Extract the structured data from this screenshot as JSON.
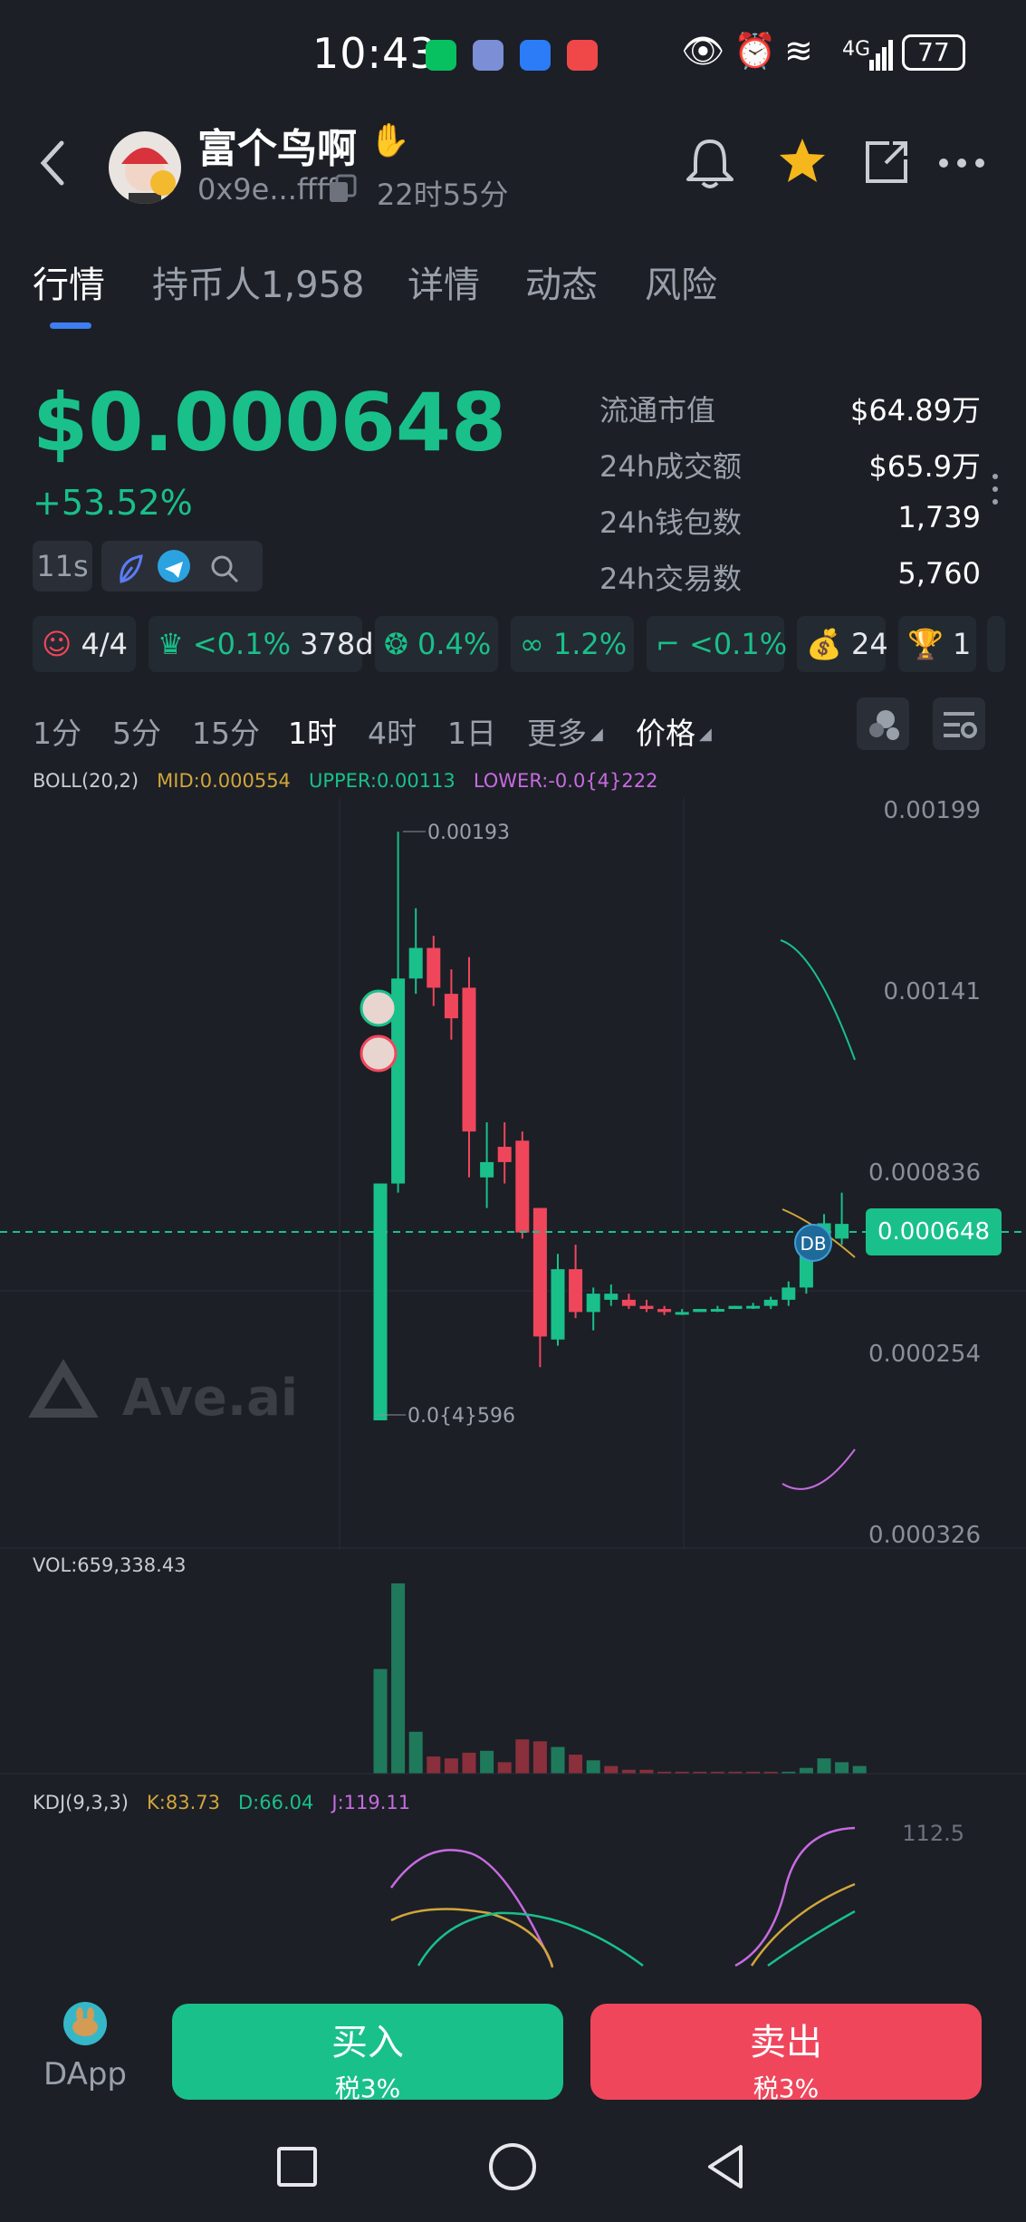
{
  "status_bar": {
    "time": "10:43",
    "network": "4G",
    "battery": "77"
  },
  "header": {
    "title": "富个鸟啊",
    "address": "0x9e...ffff",
    "age": "22时55分"
  },
  "tabs": [
    "行情",
    "持币人1,958",
    "详情",
    "动态",
    "风险"
  ],
  "price": {
    "value": "$0.000648",
    "change": "+53.52%"
  },
  "refresh": "11s",
  "stats": [
    {
      "label": "流通市值",
      "value": "$64.89万"
    },
    {
      "label": "24h成交额",
      "value": "$65.9万"
    },
    {
      "label": "24h钱包数",
      "value": "1,739"
    },
    {
      "label": "24h交易数",
      "value": "5,760"
    }
  ],
  "badges": [
    {
      "icon": "holder-icon",
      "text": "4/4",
      "color": "#e6e8ec"
    },
    {
      "icon": "chef-icon",
      "text": "<0.1%",
      "extra": "378d",
      "color": "#19c08a"
    },
    {
      "icon": "bundle-icon",
      "text": "0.4%",
      "color": "#19c08a"
    },
    {
      "icon": "link-icon",
      "text": "1.2%",
      "color": "#19c08a"
    },
    {
      "icon": "sniper-icon",
      "text": "<0.1%",
      "color": "#19c08a"
    },
    {
      "icon": "money-bag-icon",
      "text": "24",
      "color": "#e6e8ec"
    },
    {
      "icon": "trophy-icon",
      "text": "1",
      "color": "#e6e8ec"
    }
  ],
  "timeframes": [
    "1分",
    "5分",
    "15分",
    "1时",
    "4时",
    "1日",
    "更多",
    "价格"
  ],
  "active_timeframe": "1时",
  "boll": {
    "label": "BOLL(20,2)",
    "mid": "MID:0.000554",
    "upper": "UPPER:0.00113",
    "lower": "LOWER:-0.0{4}222"
  },
  "axis": {
    "y1": "0.00199",
    "y2": "0.00141",
    "y3": "0.000836",
    "y4": "0.000254",
    "y5": "0.000326",
    "current": "0.000648"
  },
  "annotations": {
    "high": "0.00193",
    "low": "0.0{4}596",
    "marker": "DB"
  },
  "watermark": "Ave.ai",
  "volume": {
    "label": "VOL:659,338.43"
  },
  "kdj": {
    "label": "KDJ(9,3,3)",
    "k": "K:83.73",
    "d": "D:66.04",
    "j": "J:119.11",
    "axis": "112.5"
  },
  "colors": {
    "up": "#19c08a",
    "down": "#f0465c",
    "accent": "#3d7ef0",
    "star": "#f5b71b"
  },
  "footer": {
    "dapp": "DApp",
    "buy": "买入",
    "buy_tax": "税3%",
    "sell": "卖出",
    "sell_tax": "税3%"
  },
  "chart_data": {
    "type": "candlestick",
    "ylim": [
      0.000326,
      0.00199
    ],
    "candles": [
      {
        "o": 5.96e-06,
        "h": 0.00078,
        "l": 5.96e-06,
        "c": 0.00078,
        "dir": "up"
      },
      {
        "o": 0.00078,
        "h": 0.00193,
        "l": 0.00075,
        "c": 0.00145,
        "dir": "up"
      },
      {
        "o": 0.00145,
        "h": 0.00168,
        "l": 0.0014,
        "c": 0.00155,
        "dir": "up"
      },
      {
        "o": 0.00155,
        "h": 0.00159,
        "l": 0.00136,
        "c": 0.00142,
        "dir": "down"
      },
      {
        "o": 0.0014,
        "h": 0.00148,
        "l": 0.00125,
        "c": 0.00132,
        "dir": "down"
      },
      {
        "o": 0.00142,
        "h": 0.00152,
        "l": 0.0008,
        "c": 0.00095,
        "dir": "down"
      },
      {
        "o": 0.0008,
        "h": 0.00098,
        "l": 0.0007,
        "c": 0.00085,
        "dir": "up"
      },
      {
        "o": 0.00085,
        "h": 0.00098,
        "l": 0.00078,
        "c": 0.0009,
        "dir": "down"
      },
      {
        "o": 0.00092,
        "h": 0.00095,
        "l": 0.0006,
        "c": 0.00062,
        "dir": "down"
      },
      {
        "o": 0.0007,
        "h": 0.0007,
        "l": 0.00018,
        "c": 0.00028,
        "dir": "down"
      },
      {
        "o": 0.00027,
        "h": 0.00055,
        "l": 0.00025,
        "c": 0.0005,
        "dir": "up"
      },
      {
        "o": 0.0005,
        "h": 0.00058,
        "l": 0.00034,
        "c": 0.00036,
        "dir": "down"
      },
      {
        "o": 0.00036,
        "h": 0.00044,
        "l": 0.0003,
        "c": 0.00042,
        "dir": "up"
      },
      {
        "o": 0.00042,
        "h": 0.00045,
        "l": 0.00038,
        "c": 0.0004,
        "dir": "up"
      },
      {
        "o": 0.0004,
        "h": 0.00042,
        "l": 0.00037,
        "c": 0.00038,
        "dir": "down"
      },
      {
        "o": 0.00038,
        "h": 0.0004,
        "l": 0.00036,
        "c": 0.00037,
        "dir": "down"
      },
      {
        "o": 0.00037,
        "h": 0.00038,
        "l": 0.00035,
        "c": 0.00036,
        "dir": "down"
      },
      {
        "o": 0.00036,
        "h": 0.00037,
        "l": 0.00035,
        "c": 0.00036,
        "dir": "up"
      },
      {
        "o": 0.00036,
        "h": 0.00037,
        "l": 0.00036,
        "c": 0.00037,
        "dir": "up"
      },
      {
        "o": 0.00037,
        "h": 0.00038,
        "l": 0.00036,
        "c": 0.00037,
        "dir": "up"
      },
      {
        "o": 0.00037,
        "h": 0.00038,
        "l": 0.00037,
        "c": 0.00038,
        "dir": "up"
      },
      {
        "o": 0.00038,
        "h": 0.00039,
        "l": 0.00037,
        "c": 0.00038,
        "dir": "up"
      },
      {
        "o": 0.00038,
        "h": 0.00041,
        "l": 0.00037,
        "c": 0.0004,
        "dir": "up"
      },
      {
        "o": 0.0004,
        "h": 0.00046,
        "l": 0.00038,
        "c": 0.00044,
        "dir": "up"
      },
      {
        "o": 0.00044,
        "h": 0.00058,
        "l": 0.00042,
        "c": 0.00056,
        "dir": "up"
      },
      {
        "o": 0.00056,
        "h": 0.00068,
        "l": 0.00054,
        "c": 0.00065,
        "dir": "up"
      },
      {
        "o": 0.0006,
        "h": 0.00075,
        "l": 0.00058,
        "c": 0.000648,
        "dir": "up"
      }
    ],
    "volumes": [
      0.55,
      1.0,
      0.22,
      0.09,
      0.08,
      0.11,
      0.12,
      0.06,
      0.18,
      0.17,
      0.14,
      0.1,
      0.07,
      0.04,
      0.02,
      0.02,
      0.01,
      0.01,
      0.01,
      0.01,
      0.01,
      0.01,
      0.01,
      0.01,
      0.03,
      0.08,
      0.06,
      0.04
    ]
  }
}
